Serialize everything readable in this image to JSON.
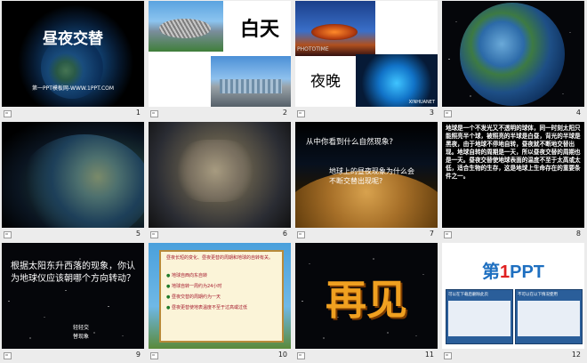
{
  "slides": [
    {
      "number": "1",
      "title": "昼夜交替",
      "subtitle": "第一PPT模板网-WWW.1PPT.COM"
    },
    {
      "number": "2",
      "label": "白天"
    },
    {
      "number": "3",
      "label": "夜晚",
      "watermark": "PHOTOTIME",
      "credit": "XINHUANET"
    },
    {
      "number": "4"
    },
    {
      "number": "5"
    },
    {
      "number": "6"
    },
    {
      "number": "7",
      "question": "从中你看到什么自然现象?",
      "answer": "地球上的昼夜现象为什么会不断交替出现呢?"
    },
    {
      "number": "8",
      "body": "地球是一个不发光又不透明的球体，同一时刻太阳只能照亮半个球，被照亮的半球是白昼，背光的半球是黑夜，由于地球不停地自转，昼夜就不断地交替出现。地球自转的周期是一天，所以昼夜交替的周期也是一天。昼夜交替使地球表面的温度不至于太高或太低，适合生物的生存，这是地球上生命存在的重要条件之一。"
    },
    {
      "number": "9",
      "text": "根据太阳东升西落的现象，你认为地球仪应该朝哪个方向转动？",
      "sign1": "轻轻交",
      "sign2": "替现象"
    },
    {
      "number": "10",
      "list_intro": "昼夜长短的变化、昼夜更替的周期和地球的自转有关。",
      "items": [
        "地球自西向东自转",
        "地球自转一周约为24小时",
        "昼夜交替的周期约为一天",
        "昼夜更替使地表温度不至于过高或过低"
      ]
    },
    {
      "number": "11",
      "text": "再见"
    },
    {
      "number": "12",
      "logo_prefix": "第",
      "logo_digit": "1",
      "logo_suffix": "PPT",
      "box1": "可以在下载后删除此页",
      "box2": "不可以在以下情况使用"
    }
  ],
  "colors": {
    "background": "#ececec",
    "title_white": "#ffffff",
    "gold": "#f0a020",
    "blue_logo": "#1e6fc0"
  }
}
